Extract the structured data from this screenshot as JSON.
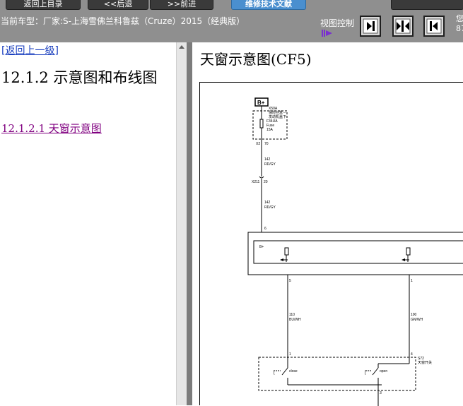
{
  "toolbar": {
    "buttons": [
      {
        "label": "返回上目录"
      },
      {
        "label": "<<后退"
      },
      {
        "label": ">>前进"
      },
      {
        "label": "维修技术文献"
      }
    ]
  },
  "vehicle_info": "当前车型：厂家:S-上海雪佛兰科鲁兹（Cruze）2015（经典版）",
  "view_control": {
    "label": "视图控制"
  },
  "right_clip_text": [
    "您",
    "87"
  ],
  "nav": {
    "back_link": "[返回上一级]",
    "section_title": "12.1.2 示意图和布线图",
    "sub_link": "12.1.2.1 天窗示意图"
  },
  "content": {
    "title": "天窗示意图(CF5)"
  },
  "diagram": {
    "battery_label": "B+",
    "fuse_block": "X50A",
    "fuse_desc1": "保险丝盒－",
    "fuse_desc2": "发动机盖下",
    "fuse_id": "F34UA",
    "fuse_word": "Fuse",
    "fuse_rating": "15A",
    "conn_x2": "X2",
    "pin_70": "70",
    "wire1_num": "142",
    "wire1_color": "RD/GY",
    "conn_x211": "X211",
    "pin_20": "20",
    "wire2_num": "142",
    "wire2_color": "RD/GY",
    "pin_6": "6",
    "module_bplus": "B+",
    "pin_5": "5",
    "pin_1": "1",
    "wire3_num": "110",
    "wire3_color": "BU/WH",
    "wire4_num": "100",
    "wire4_color": "GN/WH",
    "sw_pin1": "1",
    "sw_pin4": "4",
    "switch_id": "S72",
    "switch_desc": "天窗开关",
    "close_label": "close",
    "open_label": "open",
    "sw_pin3": "3"
  }
}
